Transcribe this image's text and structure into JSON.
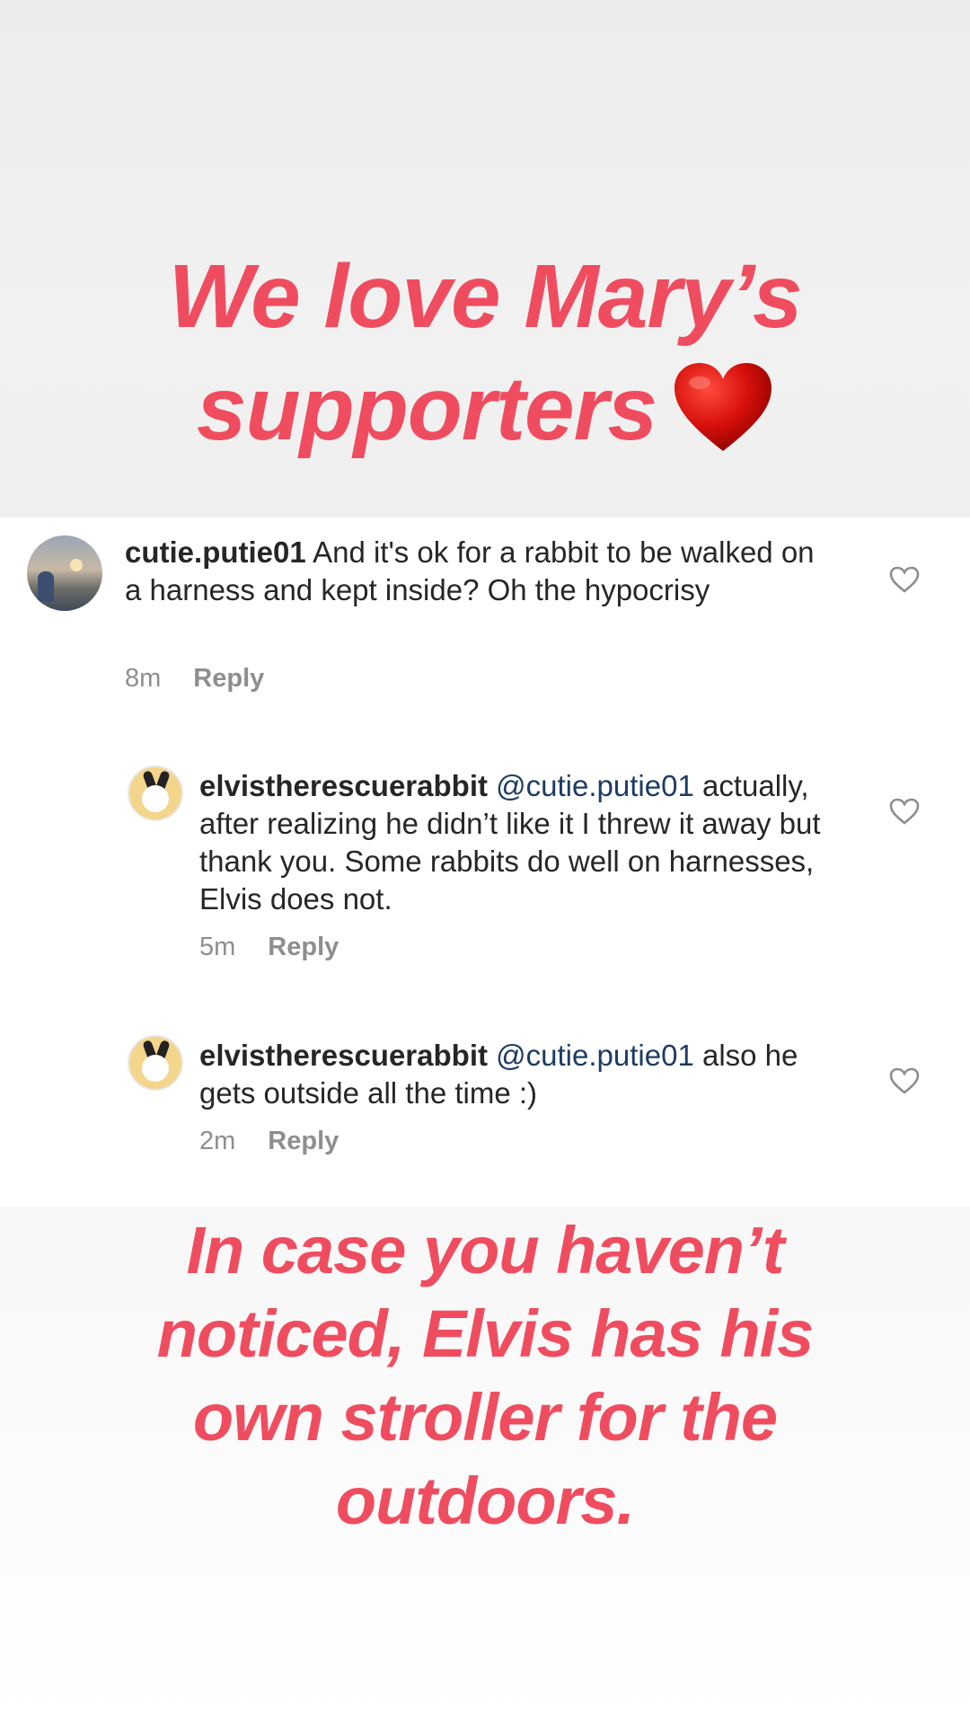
{
  "headline_top": {
    "line1": "We love Mary’s",
    "line2": "supporters",
    "emoji": "red-heart-icon",
    "color": "#ef4d5f"
  },
  "comments": [
    {
      "username": "cutie.putie01",
      "text": " And it's ok for a rabbit to be walked on a harness and kept inside? Oh the hypocrisy",
      "time": "8m",
      "reply_label": "Reply",
      "avatar": "photo-avatar",
      "like_icon": "heart-outline-icon"
    },
    {
      "username": "elvistherescuerabbit",
      "mention": " @cutie.putie01",
      "text": " actually, after realizing he didn’t like it I threw it away but thank you. Some rabbits do well on harnesses, Elvis does not.",
      "time": "5m",
      "reply_label": "Reply",
      "avatar": "rabbit-avatar",
      "like_icon": "heart-outline-icon"
    },
    {
      "username": "elvistherescuerabbit",
      "mention": " @cutie.putie01",
      "text": " also he gets outside all the time :)",
      "time": "2m",
      "reply_label": "Reply",
      "avatar": "rabbit-avatar",
      "like_icon": "heart-outline-icon"
    }
  ],
  "headline_bottom": {
    "line1": "In case you haven’t",
    "line2": "noticed, Elvis has his",
    "line3": "own stroller for the",
    "line4": "outdoors.",
    "color": "#ef4d5f"
  }
}
